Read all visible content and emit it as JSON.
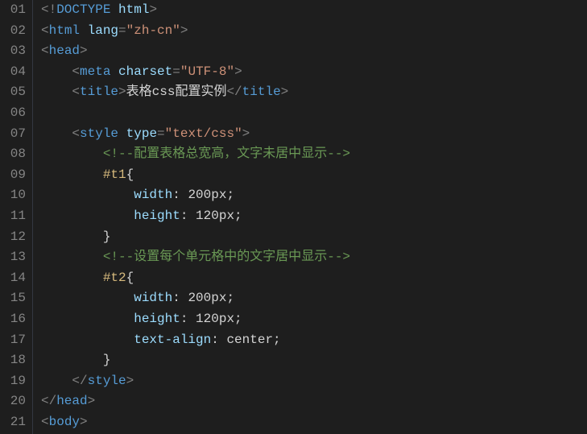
{
  "lines": [
    {
      "num": "01",
      "indent": 0,
      "tokens": [
        {
          "cls": "punct",
          "t": "<!"
        },
        {
          "cls": "tag",
          "t": "DOCTYPE"
        },
        {
          "cls": "text",
          "t": " "
        },
        {
          "cls": "attr-name",
          "t": "html"
        },
        {
          "cls": "punct",
          "t": ">"
        }
      ]
    },
    {
      "num": "02",
      "indent": 0,
      "tokens": [
        {
          "cls": "punct",
          "t": "<"
        },
        {
          "cls": "tag",
          "t": "html"
        },
        {
          "cls": "text",
          "t": " "
        },
        {
          "cls": "attr-name",
          "t": "lang"
        },
        {
          "cls": "punct",
          "t": "="
        },
        {
          "cls": "attr-val",
          "t": "\"zh-cn\""
        },
        {
          "cls": "punct",
          "t": ">"
        }
      ]
    },
    {
      "num": "03",
      "indent": 0,
      "tokens": [
        {
          "cls": "punct",
          "t": "<"
        },
        {
          "cls": "tag",
          "t": "head"
        },
        {
          "cls": "punct",
          "t": ">"
        }
      ]
    },
    {
      "num": "04",
      "indent": 1,
      "tokens": [
        {
          "cls": "punct",
          "t": "<"
        },
        {
          "cls": "tag",
          "t": "meta"
        },
        {
          "cls": "text",
          "t": " "
        },
        {
          "cls": "attr-name",
          "t": "charset"
        },
        {
          "cls": "punct",
          "t": "="
        },
        {
          "cls": "attr-val",
          "t": "\"UTF-8\""
        },
        {
          "cls": "punct",
          "t": ">"
        }
      ]
    },
    {
      "num": "05",
      "indent": 1,
      "tokens": [
        {
          "cls": "punct",
          "t": "<"
        },
        {
          "cls": "tag",
          "t": "title"
        },
        {
          "cls": "punct",
          "t": ">"
        },
        {
          "cls": "text",
          "t": "表格css配置实例"
        },
        {
          "cls": "punct",
          "t": "</"
        },
        {
          "cls": "tag",
          "t": "title"
        },
        {
          "cls": "punct",
          "t": ">"
        }
      ]
    },
    {
      "num": "06",
      "indent": 0,
      "tokens": []
    },
    {
      "num": "07",
      "indent": 1,
      "tokens": [
        {
          "cls": "punct",
          "t": "<"
        },
        {
          "cls": "tag",
          "t": "style"
        },
        {
          "cls": "text",
          "t": " "
        },
        {
          "cls": "attr-name",
          "t": "type"
        },
        {
          "cls": "punct",
          "t": "="
        },
        {
          "cls": "attr-val",
          "t": "\"text/css\""
        },
        {
          "cls": "punct",
          "t": ">"
        }
      ]
    },
    {
      "num": "08",
      "indent": 2,
      "tokens": [
        {
          "cls": "comment",
          "t": "<!--配置表格总宽高，文字未居中显示-->"
        }
      ]
    },
    {
      "num": "09",
      "indent": 2,
      "tokens": [
        {
          "cls": "selector",
          "t": "#t1"
        },
        {
          "cls": "brace",
          "t": "{"
        }
      ]
    },
    {
      "num": "10",
      "indent": 3,
      "tokens": [
        {
          "cls": "prop",
          "t": "width"
        },
        {
          "cls": "text",
          "t": ": "
        },
        {
          "cls": "num",
          "t": "200px"
        },
        {
          "cls": "text",
          "t": ";"
        }
      ]
    },
    {
      "num": "11",
      "indent": 3,
      "tokens": [
        {
          "cls": "prop",
          "t": "height"
        },
        {
          "cls": "text",
          "t": ": "
        },
        {
          "cls": "num",
          "t": "120px"
        },
        {
          "cls": "text",
          "t": ";"
        }
      ]
    },
    {
      "num": "12",
      "indent": 2,
      "tokens": [
        {
          "cls": "brace",
          "t": "}"
        }
      ]
    },
    {
      "num": "13",
      "indent": 2,
      "tokens": [
        {
          "cls": "comment",
          "t": "<!--设置每个单元格中的文字居中显示-->"
        }
      ]
    },
    {
      "num": "14",
      "indent": 2,
      "tokens": [
        {
          "cls": "selector",
          "t": "#t2"
        },
        {
          "cls": "brace",
          "t": "{"
        }
      ]
    },
    {
      "num": "15",
      "indent": 3,
      "tokens": [
        {
          "cls": "prop",
          "t": "width"
        },
        {
          "cls": "text",
          "t": ": "
        },
        {
          "cls": "num",
          "t": "200px"
        },
        {
          "cls": "text",
          "t": ";"
        }
      ]
    },
    {
      "num": "16",
      "indent": 3,
      "tokens": [
        {
          "cls": "prop",
          "t": "height"
        },
        {
          "cls": "text",
          "t": ": "
        },
        {
          "cls": "num",
          "t": "120px"
        },
        {
          "cls": "text",
          "t": ";"
        }
      ]
    },
    {
      "num": "17",
      "indent": 3,
      "tokens": [
        {
          "cls": "prop",
          "t": "text-align"
        },
        {
          "cls": "text",
          "t": ": "
        },
        {
          "cls": "num",
          "t": "center"
        },
        {
          "cls": "text",
          "t": ";"
        }
      ]
    },
    {
      "num": "18",
      "indent": 2,
      "tokens": [
        {
          "cls": "brace",
          "t": "}"
        }
      ]
    },
    {
      "num": "19",
      "indent": 1,
      "tokens": [
        {
          "cls": "punct",
          "t": "</"
        },
        {
          "cls": "tag",
          "t": "style"
        },
        {
          "cls": "punct",
          "t": ">"
        }
      ]
    },
    {
      "num": "20",
      "indent": 0,
      "tokens": [
        {
          "cls": "punct",
          "t": "</"
        },
        {
          "cls": "tag",
          "t": "head"
        },
        {
          "cls": "punct",
          "t": ">"
        }
      ]
    },
    {
      "num": "21",
      "indent": 0,
      "tokens": [
        {
          "cls": "punct",
          "t": "<"
        },
        {
          "cls": "tag",
          "t": "body"
        },
        {
          "cls": "punct",
          "t": ">"
        }
      ]
    }
  ],
  "indent_unit": "    "
}
